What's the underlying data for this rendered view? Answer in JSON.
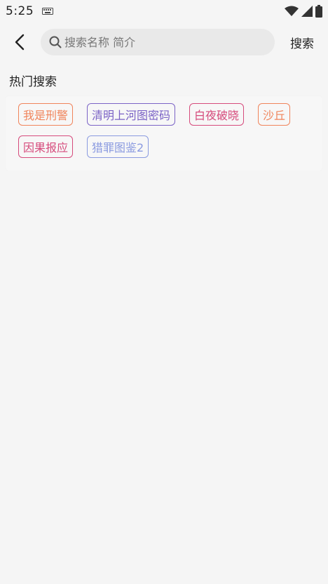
{
  "status_bar": {
    "time": "5:25",
    "icons": [
      "keyboard-icon",
      "wifi-icon",
      "cellular-signal-icon",
      "battery-icon"
    ]
  },
  "toolbar": {
    "back_icon": "chevron-left-icon",
    "search_placeholder": "搜索名称 简介",
    "search_value": "",
    "search_label": "搜索"
  },
  "hot_search": {
    "title": "热门搜索",
    "tags": [
      {
        "label": "我是刑警",
        "color": "#f0845b"
      },
      {
        "label": "清明上河图密码",
        "color": "#7b63c6"
      },
      {
        "label": "白夜破晓",
        "color": "#d64b7c"
      },
      {
        "label": "沙丘",
        "color": "#f0845b"
      },
      {
        "label": "因果报应",
        "color": "#d64b7c"
      },
      {
        "label": "猎罪图鉴2",
        "color": "#8a9ae0"
      }
    ]
  }
}
